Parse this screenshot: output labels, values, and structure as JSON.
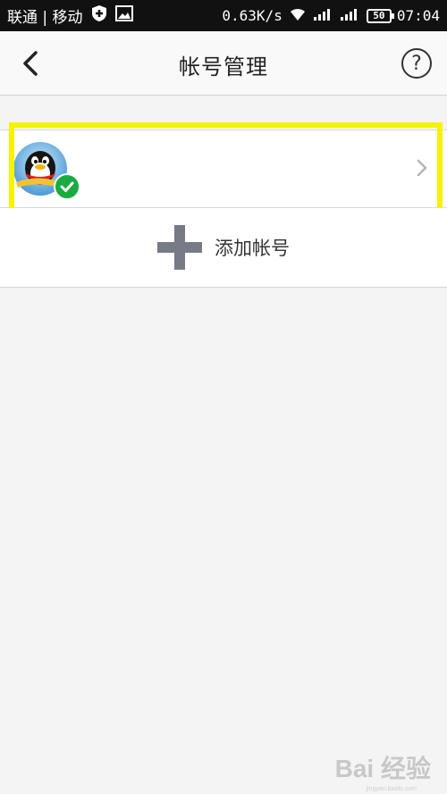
{
  "status_bar": {
    "carrier": "联通 | 移动",
    "speed": "0.63K/s",
    "battery": "50",
    "time": "07:04",
    "icons": [
      "shield-icon",
      "image-icon",
      "wifi-icon",
      "signal-icon",
      "signal-icon",
      "battery-icon"
    ]
  },
  "header": {
    "title": "帐号管理",
    "back_icon": "chevron-left-icon",
    "help_icon": "question-circle-icon",
    "help_glyph": "?"
  },
  "account": {
    "avatar_icon": "qq-penguin-avatar",
    "status_icon": "check-badge-icon",
    "status_color": "#1aab40",
    "arrow_icon": "chevron-right-icon",
    "highlight_color": "#f4f400"
  },
  "add_account": {
    "label": "添加帐号",
    "icon": "plus-icon"
  },
  "watermark": {
    "brand": "Bai 经验",
    "url": "jingyan.baidu.com"
  }
}
